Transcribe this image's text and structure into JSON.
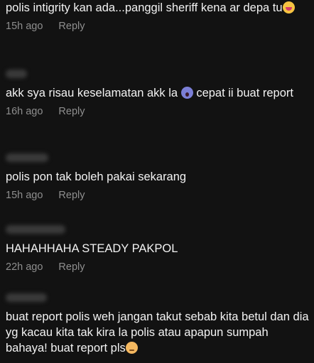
{
  "comments": [
    {
      "text": "polis intigrity kan ada...panggil sheriff kena ar depa tu",
      "emoji": "laughing-emoji",
      "time": "15h ago",
      "reply": "Reply"
    },
    {
      "text_before": "akk sya risau keselamatan akk la",
      "emoji": "screaming-emoji",
      "text_after": "cepat ii buat report",
      "time": "16h ago",
      "reply": "Reply"
    },
    {
      "text": "polis pon tak boleh pakai sekarang",
      "time": "15h ago",
      "reply": "Reply"
    },
    {
      "text": "HAHAHHAHA STEADY PAKPOL",
      "time": "22h ago",
      "reply": "Reply"
    },
    {
      "text": "buat report polis weh jangan takut sebab kita betul dan dia yg kacau kita tak kira la polis atau apapun sumpah bahaya! buat report pls",
      "emoji": "flushed-emoji"
    }
  ]
}
